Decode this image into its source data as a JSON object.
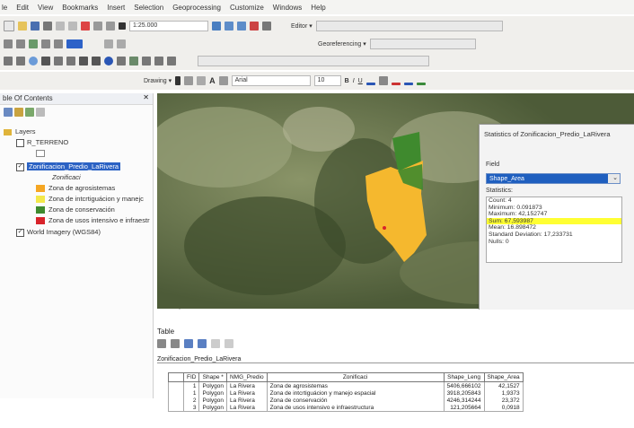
{
  "menu": [
    "le",
    "Edit",
    "View",
    "Bookmarks",
    "Insert",
    "Selection",
    "Geoprocessing",
    "Customize",
    "Windows",
    "Help"
  ],
  "toolbar": {
    "scale": "1:25.000",
    "editor_label": "Editor ▾",
    "georef_label": "Georeferencing ▾",
    "drawing_label": "Drawing ▾",
    "font_name": "Arial",
    "font_size": "10",
    "bold": "B",
    "italic": "I",
    "underline": "U",
    "text_tool": "A"
  },
  "toc": {
    "title": "ble Of Contents",
    "layers_label": "Layers",
    "layer_terreno": "R_TERRENO",
    "layer_zonificacion": "Zonificacion_Predio_LaRivera",
    "field_label": "Zonificaci",
    "classes": [
      {
        "label": "Zona de agrosistemas",
        "color": "#f5a623"
      },
      {
        "label": "Zona de intcrtiguácion y manejc",
        "color": "#f3e84a"
      },
      {
        "label": "Zona de conservación",
        "color": "#3f8a2e"
      },
      {
        "label": "Zona de usos intensivo e infraestr",
        "color": "#d8232a"
      }
    ],
    "layer_imagery": "World Imagery (WGS84)"
  },
  "stats": {
    "title": "Statistics of Zonificacion_Predio_LaRivera",
    "field_label": "Field",
    "field_value": "Shape_Area",
    "statistics_label": "Statistics:",
    "lines": [
      {
        "text": "Count:  4",
        "highlight": false
      },
      {
        "text": "Minimum:  0.091873",
        "highlight": false
      },
      {
        "text": "Maximum:  42,152747",
        "highlight": false
      },
      {
        "text": "Sum:   67,593987",
        "highlight": true
      },
      {
        "text": "Mean:   16.898472",
        "highlight": false
      },
      {
        "text": "Standard Deviation: 17,233731",
        "highlight": false
      },
      {
        "text": "Nulls:   0",
        "highlight": false
      }
    ]
  },
  "map_footer": "⊡ ⊞  ⟳ ‖  ‹",
  "table": {
    "window_title": "Table",
    "layer_tab": "Zonificacion_Predio_LaRivera",
    "headers": [
      "FID",
      "Shape *",
      "NMG_Predio",
      "Zonificaci",
      "Shape_Leng",
      "Shape_Area"
    ],
    "rows": [
      [
        "1",
        "Polygon",
        "La Rivera",
        "Zona de agrosistemas",
        "5406,666102",
        "42,1527"
      ],
      [
        "1",
        "Polygon",
        "La Rivera",
        "Zona de intcrtiguácion y manejo espacial",
        "3918,205843",
        "1,9373"
      ],
      [
        "2",
        "Polygon",
        "La Rivera",
        "Zona de conservación",
        "4246,314244",
        "23,372"
      ],
      [
        "3",
        "Polygon",
        "La Rivera",
        "Zona de usos intensivo e infraestructura",
        "121,205664",
        "0,0918"
      ]
    ]
  }
}
